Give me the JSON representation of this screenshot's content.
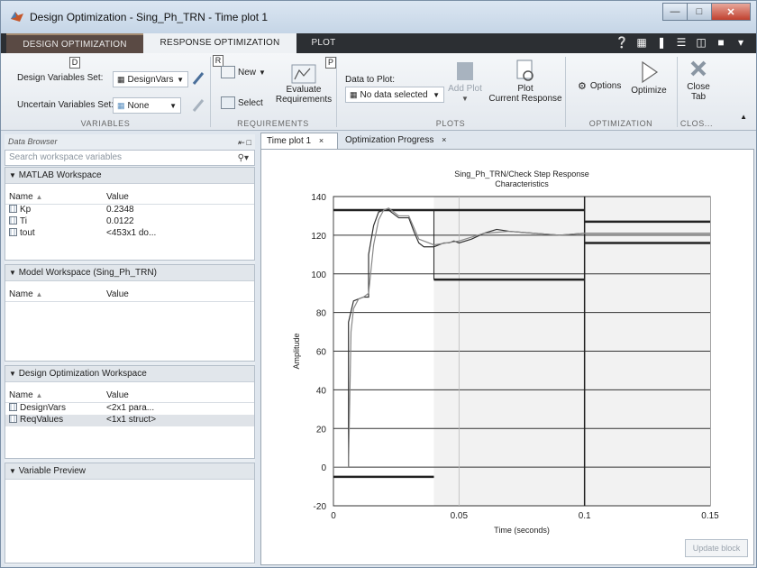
{
  "window": {
    "title": "Design Optimization - Sing_Ph_TRN - Time plot 1"
  },
  "tabs": [
    {
      "label": "DESIGN OPTIMIZATION"
    },
    {
      "label": "RESPONSE OPTIMIZATION"
    },
    {
      "label": "PLOT"
    }
  ],
  "ribbon": {
    "key_tips": {
      "design": "D",
      "requirements": "R",
      "plot": "P"
    },
    "design_vars_label": "Design Variables Set:",
    "design_vars_value": "DesignVars",
    "uncertain_vars_label": "Uncertain Variables Set:",
    "uncertain_vars_value": "None",
    "new_label": "New",
    "select_label": "Select",
    "evaluate_label_1": "Evaluate",
    "evaluate_label_2": "Requirements",
    "data_to_plot_label": "Data to Plot:",
    "data_to_plot_value": "No data selected",
    "add_plot_label": "Add Plot",
    "plot_current_1": "Plot",
    "plot_current_2": "Current Response",
    "options_label": "Options",
    "optimize_label": "Optimize",
    "close_tab_1": "Close",
    "close_tab_2": "Tab",
    "sections": {
      "variables": "VARIABLES",
      "requirements": "REQUIREMENTS",
      "plots": "PLOTS",
      "optimization": "OPTIMIZATION",
      "close": "CLOS..."
    }
  },
  "browser": {
    "header": "Data Browser",
    "search_placeholder": "Search workspace variables",
    "col_name": "Name",
    "col_value": "Value",
    "matlab_ws": {
      "title": "MATLAB Workspace",
      "rows": [
        {
          "name": "Kp",
          "value": "0.2348"
        },
        {
          "name": "Ti",
          "value": "0.0122"
        },
        {
          "name": "tout",
          "value": "<453x1 do..."
        }
      ]
    },
    "model_ws": {
      "title": "Model Workspace (Sing_Ph_TRN)"
    },
    "design_ws": {
      "title": "Design Optimization Workspace",
      "rows": [
        {
          "name": "DesignVars",
          "value": "<2x1 para..."
        },
        {
          "name": "ReqValues",
          "value": "<1x1 struct>"
        }
      ]
    },
    "preview": {
      "title": "Variable Preview"
    }
  },
  "doc_tabs": [
    {
      "label": "Time plot 1"
    },
    {
      "label": "Optimization Progress"
    }
  ],
  "update_block_label": "Update block",
  "chart_data": {
    "type": "line",
    "title": "Sing_Ph_TRN/Check Step Response Characteristics",
    "title_line1": "Sing_Ph_TRN/Check Step Response",
    "title_line2": "Characteristics",
    "xlabel": "Time (seconds)",
    "ylabel": "Amplitude",
    "xlim": [
      0,
      0.15
    ],
    "ylim": [
      -20,
      140
    ],
    "xticks": [
      0,
      0.05,
      0.1,
      0.15
    ],
    "xtick_labels": [
      "0",
      "0.05",
      "0.1",
      "0.15"
    ],
    "yticks": [
      -20,
      0,
      20,
      40,
      60,
      80,
      100,
      120,
      140
    ],
    "grid": true,
    "series": [
      {
        "x": [
          0,
          0.006,
          0.006,
          0.008,
          0.01,
          0.012,
          0.014,
          0.014,
          0.016,
          0.018,
          0.02,
          0.022,
          0.024,
          0.026,
          0.028,
          0.03,
          0.032,
          0.034,
          0.036,
          0.038,
          0.04,
          0.042,
          0.044,
          0.046,
          0.048,
          0.05,
          0.055,
          0.06,
          0.065,
          0.07,
          0.08,
          0.09,
          0.1,
          0.11,
          0.12,
          0.15
        ],
        "y": [
          0,
          0,
          75,
          86,
          87,
          88,
          88,
          110,
          125,
          132,
          133,
          133,
          131,
          129,
          129,
          129,
          122,
          116,
          114,
          114,
          114,
          115,
          116,
          116,
          117,
          116,
          118,
          121,
          123,
          122,
          121,
          120,
          121,
          121,
          121,
          121
        ]
      },
      {
        "x": [
          0,
          0.006,
          0.007,
          0.008,
          0.01,
          0.012,
          0.014,
          0.016,
          0.018,
          0.02,
          0.022,
          0.024,
          0.026,
          0.028,
          0.03,
          0.034,
          0.04,
          0.05,
          0.06,
          0.07,
          0.08,
          0.09,
          0.1,
          0.12,
          0.15
        ],
        "y": [
          0,
          0,
          70,
          82,
          87,
          88,
          90,
          115,
          128,
          133,
          134,
          132,
          130,
          130,
          130,
          118,
          115,
          117,
          121,
          122,
          121,
          120,
          121,
          121,
          121
        ]
      }
    ],
    "bounds": {
      "upper": [
        {
          "x": [
            0,
            0.1
          ],
          "y": 133
        },
        {
          "x": [
            0.1,
            0.15
          ],
          "y": 127
        }
      ],
      "lower": [
        {
          "x": [
            0,
            0.04
          ],
          "y": -5
        },
        {
          "x": [
            0.04,
            0.1
          ],
          "y": 97
        },
        {
          "x": [
            0.1,
            0.15
          ],
          "y": 116
        }
      ]
    }
  }
}
